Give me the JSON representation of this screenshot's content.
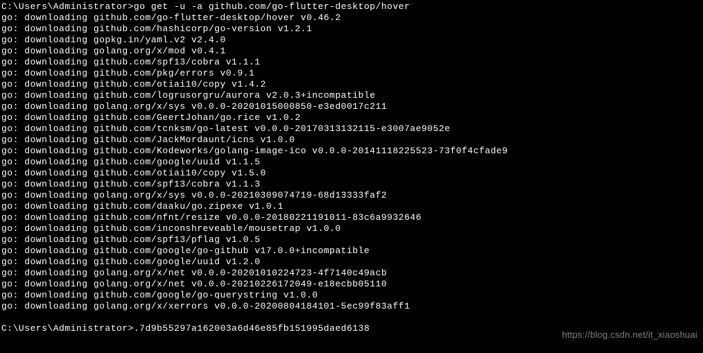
{
  "terminal": {
    "lines": [
      "C:\\Users\\Administrator>go get -u -a github.com/go-flutter-desktop/hover",
      "go: downloading github.com/go-flutter-desktop/hover v0.46.2",
      "go: downloading github.com/hashicorp/go-version v1.2.1",
      "go: downloading gopkg.in/yaml.v2 v2.4.0",
      "go: downloading golang.org/x/mod v0.4.1",
      "go: downloading github.com/spf13/cobra v1.1.1",
      "go: downloading github.com/pkg/errors v0.9.1",
      "go: downloading github.com/otiai10/copy v1.4.2",
      "go: downloading github.com/logrusorgru/aurora v2.0.3+incompatible",
      "go: downloading golang.org/x/sys v0.0.0-20201015000850-e3ed0017c211",
      "go: downloading github.com/GeertJohan/go.rice v1.0.2",
      "go: downloading github.com/tcnksm/go-latest v0.0.0-20170313132115-e3007ae9052e",
      "go: downloading github.com/JackMordaunt/icns v1.0.0",
      "go: downloading github.com/Kodeworks/golang-image-ico v0.0.0-20141118225523-73f0f4cfade9",
      "go: downloading github.com/google/uuid v1.1.5",
      "go: downloading github.com/otiai10/copy v1.5.0",
      "go: downloading github.com/spf13/cobra v1.1.3",
      "go: downloading golang.org/x/sys v0.0.0-20210309074719-68d13333faf2",
      "go: downloading github.com/daaku/go.zipexe v1.0.1",
      "go: downloading github.com/nfnt/resize v0.0.0-20180221191011-83c6a9932646",
      "go: downloading github.com/inconshreveable/mousetrap v1.0.0",
      "go: downloading github.com/spf13/pflag v1.0.5",
      "go: downloading github.com/google/go-github v17.0.0+incompatible",
      "go: downloading github.com/google/uuid v1.2.0",
      "go: downloading golang.org/x/net v0.0.0-20201010224723-4f7140c49acb",
      "go: downloading golang.org/x/net v0.0.0-20210226172049-e18ecbb05110",
      "go: downloading github.com/google/go-querystring v1.0.0",
      "go: downloading golang.org/x/xerrors v0.0.0-20200804184101-5ec99f83aff1",
      "",
      "C:\\Users\\Administrator>.7d9b55297a162003a6d46e85fb151995daed6138"
    ]
  },
  "watermark": "https://blog.csdn.net/it_xiaoshuai"
}
